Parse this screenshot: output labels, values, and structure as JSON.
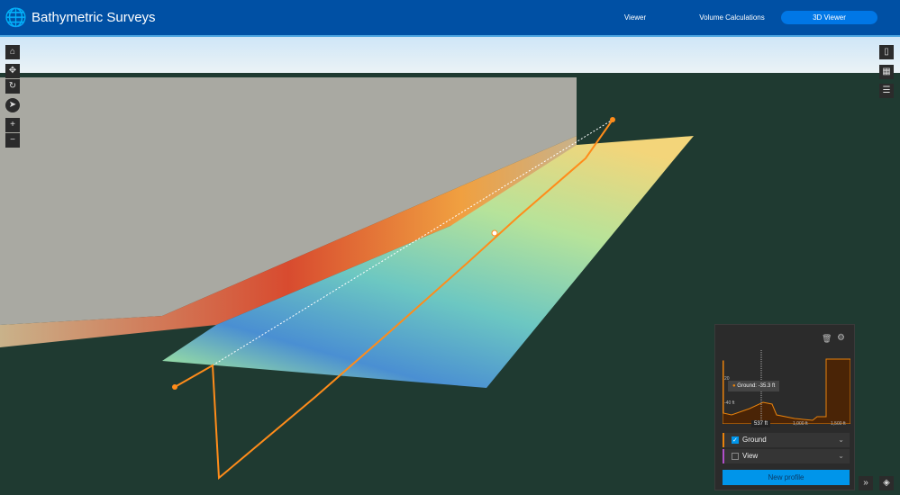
{
  "header": {
    "title": "Bathymetric Surveys",
    "logo_icon": "globe-person-icon",
    "nav": [
      {
        "label": "Viewer"
      },
      {
        "label": "Volume Calculations"
      },
      {
        "label": "3D Viewer",
        "active": true
      }
    ],
    "color": "#0050a4",
    "active_color": "#0077e6"
  },
  "left_toolbar": [
    "home-icon",
    "pan-icon",
    "rotate-icon",
    "compass-icon",
    "zoom-in-icon",
    "zoom-out-icon"
  ],
  "right_toolbar": [
    "bookmark-icon",
    "basemap-icon",
    "layer-list-icon"
  ],
  "profile": {
    "tooltip": "Ground: -35.3 ft",
    "y_labels": [
      "20",
      "-40 ft"
    ],
    "x_labels": [
      "537 ft",
      "1,000 ft",
      "1,500 ft"
    ],
    "lines": [
      {
        "label": "Ground",
        "checked": true,
        "color": "#e8820c"
      },
      {
        "label": "View",
        "checked": false,
        "color": "#b04fc9"
      }
    ],
    "new_profile": "New profile"
  },
  "colors": {
    "profile_line": "#ff8c1a",
    "panel_bg": "#2b2b2b",
    "button": "#0095ea"
  }
}
